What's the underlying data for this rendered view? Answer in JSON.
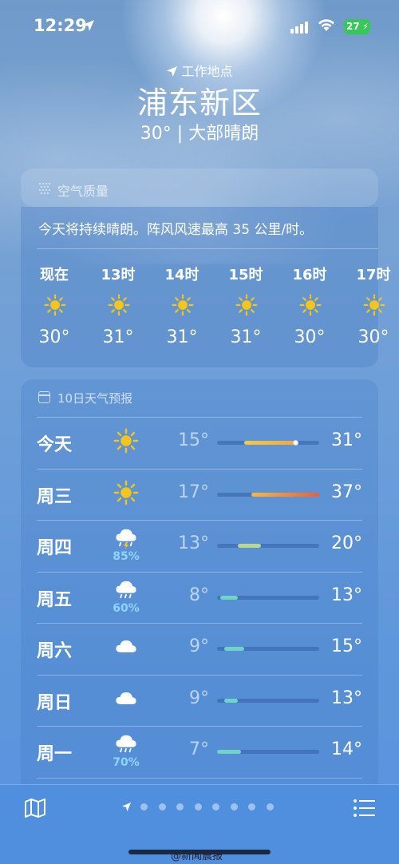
{
  "status_bar": {
    "time": "12:29",
    "battery": "27"
  },
  "header": {
    "location_label": "工作地点",
    "city": "浦东新区",
    "condition": "30° | 大部晴朗"
  },
  "air_quality": {
    "title": "空气质量"
  },
  "hourly": {
    "summary": "今天将持续晴朗。阵风风速最高 35 公里/时。",
    "items": [
      {
        "label": "现在",
        "icon": "sun-icon",
        "temp": "30°"
      },
      {
        "label": "13时",
        "icon": "sun-icon",
        "temp": "31°"
      },
      {
        "label": "14时",
        "icon": "sun-icon",
        "temp": "31°"
      },
      {
        "label": "15时",
        "icon": "sun-icon",
        "temp": "31°"
      },
      {
        "label": "16时",
        "icon": "sun-icon",
        "temp": "30°"
      },
      {
        "label": "17时",
        "icon": "sun-icon",
        "temp": "30°"
      }
    ]
  },
  "daily": {
    "title": "10日天气预报",
    "range_min": 7,
    "range_max": 37,
    "items": [
      {
        "day": "今天",
        "icon": "sun-icon",
        "precip": "",
        "low": "15°",
        "high": "31°",
        "low_v": 15,
        "high_v": 31,
        "current_v": 30,
        "color": "#f2b84a"
      },
      {
        "day": "周三",
        "icon": "sun-icon",
        "precip": "",
        "low": "17°",
        "high": "37°",
        "low_v": 17,
        "high_v": 37,
        "color": "#ee8a3c"
      },
      {
        "day": "周四",
        "icon": "thunderstorm-icon",
        "precip": "85%",
        "low": "13°",
        "high": "20°",
        "low_v": 13,
        "high_v": 20,
        "color": "#b9d98a"
      },
      {
        "day": "周五",
        "icon": "rain-icon",
        "precip": "60%",
        "low": "8°",
        "high": "13°",
        "low_v": 8,
        "high_v": 13,
        "color": "#6fd3c5"
      },
      {
        "day": "周六",
        "icon": "cloud-icon",
        "precip": "",
        "low": "9°",
        "high": "15°",
        "low_v": 9,
        "high_v": 15,
        "color": "#6fd3c5"
      },
      {
        "day": "周日",
        "icon": "cloud-icon",
        "precip": "",
        "low": "9°",
        "high": "13°",
        "low_v": 9,
        "high_v": 13,
        "color": "#6fd3c5"
      },
      {
        "day": "周一",
        "icon": "rain-icon",
        "precip": "70%",
        "low": "7°",
        "high": "14°",
        "low_v": 7,
        "high_v": 14,
        "color": "#6fd3c5"
      }
    ]
  },
  "toolbar": {
    "page_count": 9
  },
  "watermark": "@新闻晨报"
}
